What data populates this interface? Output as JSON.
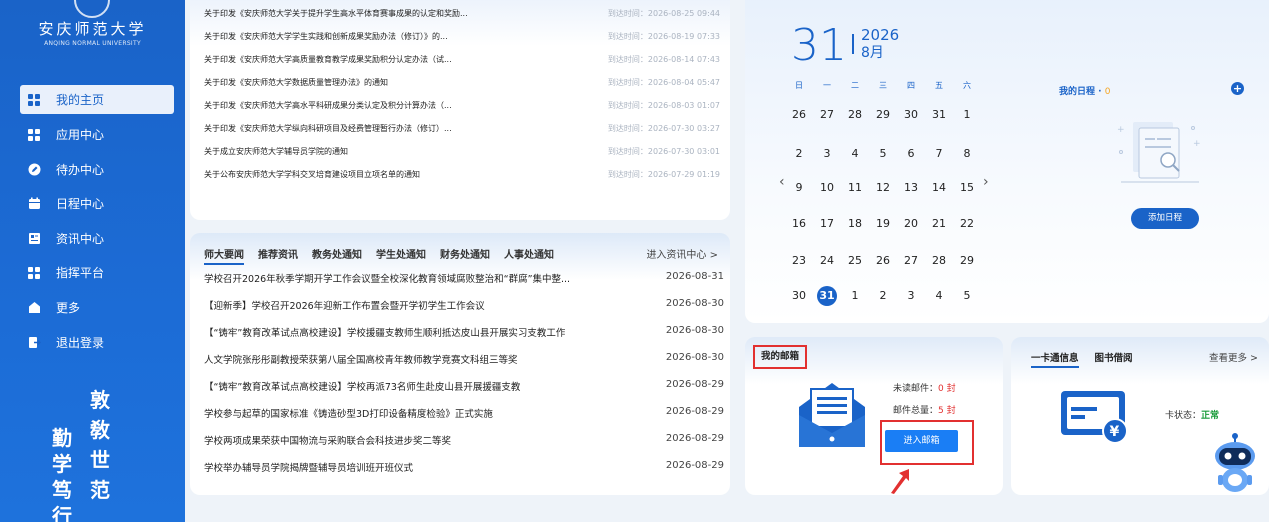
{
  "brand": {
    "name_cn": "安庆师范大学",
    "name_en": "ANQING NORMAL UNIVERSITY"
  },
  "sidebar": {
    "items": [
      {
        "label": "我的主页",
        "icon": "grid-icon"
      },
      {
        "label": "应用中心",
        "icon": "grid-icon"
      },
      {
        "label": "待办中心",
        "icon": "pencil-icon"
      },
      {
        "label": "日程中心",
        "icon": "calendar-icon"
      },
      {
        "label": "资讯中心",
        "icon": "news-icon"
      },
      {
        "label": "指挥平台",
        "icon": "grid-icon"
      },
      {
        "label": "更多",
        "icon": "home-icon"
      },
      {
        "label": "退出登录",
        "icon": "logout-icon"
      }
    ],
    "motto": [
      "勤",
      "学",
      "笃",
      "行",
      "敦",
      "敎",
      "世",
      "范"
    ]
  },
  "notices": [
    {
      "title": "关于印发《安庆师范大学关于提升学生高水平体育赛事成果的认定和奖励...",
      "date": "到达时间：2026-08-25 09:44"
    },
    {
      "title": "关于印发《安庆师范大学学生实践和创新成果奖励办法（修订）》的...",
      "date": "到达时间：2026-08-19 07:33"
    },
    {
      "title": "关于印发《安庆师范大学高质量教育教学成果奖励积分认定办法（试...",
      "date": "到达时间：2026-08-14 07:43"
    },
    {
      "title": "关于印发《安庆师范大学数据质量管理办法》的通知",
      "date": "到达时间：2026-08-04 05:47"
    },
    {
      "title": "关于印发《安庆师范大学高水平科研成果分类认定及积分计算办法（...",
      "date": "到达时间：2026-08-03 01:07"
    },
    {
      "title": "关于印发《安庆师范大学纵向科研项目及经费管理暂行办法（修订）...",
      "date": "到达时间：2026-07-30 03:27"
    },
    {
      "title": "关于成立安庆师范大学辅导员学院的通知",
      "date": "到达时间：2026-07-30 03:01"
    },
    {
      "title": "关于公布安庆师范大学学科交叉培育建设项目立项名单的通知",
      "date": "到达时间：2026-07-29 01:19"
    }
  ],
  "news": {
    "tabs": [
      "师大要闻",
      "推荐资讯",
      "教务处通知",
      "学生处通知",
      "财务处通知",
      "人事处通知"
    ],
    "more": "进入资讯中心 >",
    "rows": [
      {
        "title": "学校召开2026年秋季学期开学工作会议暨全校深化教育领域腐败整治和“群腐”集中整...",
        "date": "2026-08-31"
      },
      {
        "title": "【迎新季】学校召开2026年迎新工作布置会暨开学初学生工作会议",
        "date": "2026-08-30"
      },
      {
        "title": "【“铸牢”教育改革试点高校建设】学校援疆支教师生顺利抵达皮山县开展实习支教工作",
        "date": "2026-08-30"
      },
      {
        "title": "人文学院张彤彤副教授荣获第八届全国高校青年教师教学竞赛文科组三等奖",
        "date": "2026-08-30"
      },
      {
        "title": "【“铸牢”教育改革试点高校建设】学校再派73名师生赴皮山县开展援疆支教",
        "date": "2026-08-29"
      },
      {
        "title": "学校参与起草的国家标准《铸造砂型3D打印设备精度检验》正式实施",
        "date": "2026-08-29"
      },
      {
        "title": "学校两项成果荣获中国物流与采购联合会科技进步奖二等奖",
        "date": "2026-08-29"
      },
      {
        "title": "学校举办辅导员学院揭牌暨辅导员培训班开班仪式",
        "date": "2026-08-29"
      }
    ]
  },
  "calendar": {
    "day": "31",
    "year": "2026",
    "month": "8月",
    "weekdays": [
      "日",
      "一",
      "二",
      "三",
      "四",
      "五",
      "六"
    ],
    "weeks": [
      [
        "26",
        "27",
        "28",
        "29",
        "30",
        "31",
        "1"
      ],
      [
        "2",
        "3",
        "4",
        "5",
        "6",
        "7",
        "8"
      ],
      [
        "9",
        "10",
        "11",
        "12",
        "13",
        "14",
        "15"
      ],
      [
        "16",
        "17",
        "18",
        "19",
        "20",
        "21",
        "22"
      ],
      [
        "23",
        "24",
        "25",
        "26",
        "27",
        "28",
        "29"
      ],
      [
        "30",
        "31",
        "1",
        "2",
        "3",
        "4",
        "5"
      ]
    ],
    "today": "31",
    "schedule_title": "我的日程 · ",
    "schedule_count": "0",
    "add_button": "添加日程"
  },
  "mail": {
    "title": "我的邮箱",
    "unread_label": "未读邮件：",
    "unread_value": "0 封",
    "total_label": "邮件总量：",
    "total_value": "5 封",
    "button": "进入邮箱"
  },
  "card": {
    "tabs": [
      "一卡通信息",
      "图书借阅"
    ],
    "more": "查看更多 >",
    "status_label": "卡状态：",
    "status_value": "正常"
  },
  "colors": {
    "primary": "#1a63c8",
    "highlight": "#e23030",
    "ok": "#1a9b3a",
    "accent": "#f5a623"
  }
}
